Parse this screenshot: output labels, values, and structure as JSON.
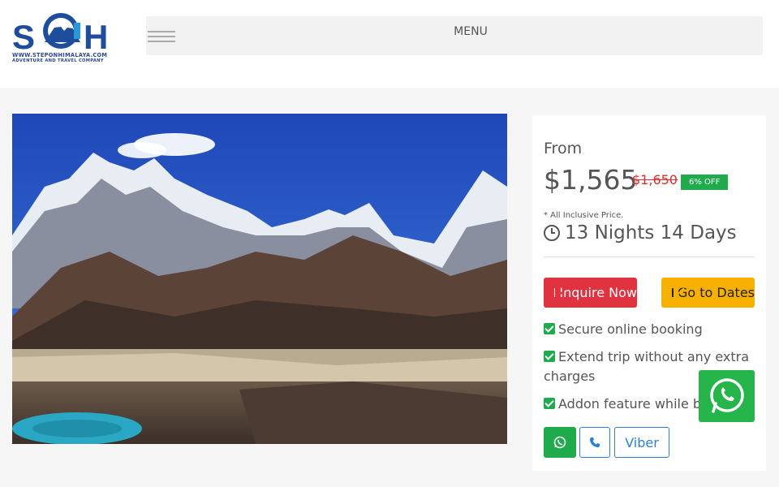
{
  "logo": {
    "brand_text": "SOH",
    "url_text": "WWW.STEPONHIMALAYA.COM",
    "tagline": "ADVENTURE AND TRAVEL COMPANY"
  },
  "nav": {
    "menu_label": "MENU"
  },
  "pricing": {
    "from_label": "From",
    "price": "$1,565",
    "original_price": "$1,650",
    "discount_badge": "6% OFF",
    "inclusive_note": "* All Inclusive Price.",
    "duration": "13 Nights 14 Days"
  },
  "buttons": {
    "inquire_label": "Inquire Now",
    "dates_label": "Go to Dates"
  },
  "features": [
    "Secure online booking",
    "Extend trip without any extra charges",
    "Addon feature while booking"
  ],
  "contact": {
    "viber_label": "Viber"
  },
  "colors": {
    "inquire": "#e0323f",
    "dates": "#f7b000",
    "discount": "#1faa4c",
    "old_price": "#d9302c",
    "whatsapp": "#25b54b",
    "link": "#2f7fd0"
  },
  "icons": {
    "hamburger": "hamburger-icon",
    "clock": "clock-icon",
    "envelope": "envelope-icon",
    "check": "check-square-icon",
    "whatsapp": "whatsapp-icon",
    "phone": "phone-icon"
  }
}
